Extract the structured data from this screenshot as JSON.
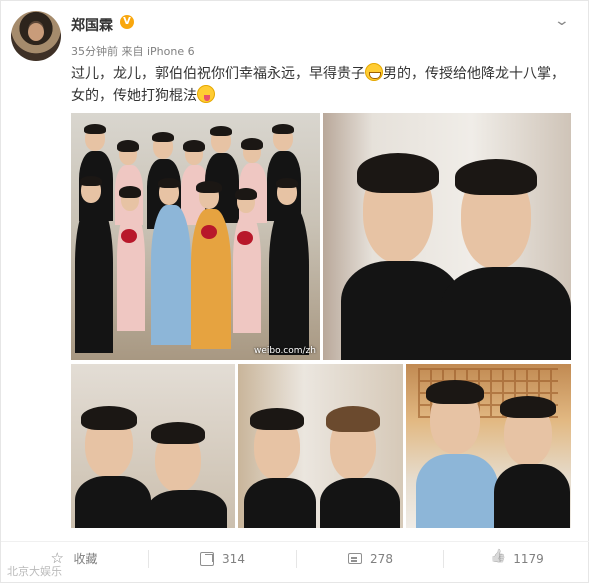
{
  "post": {
    "username": "郑国霖",
    "verified_badge": "V",
    "meta": "35分钟前 来自 iPhone 6",
    "text_lines": [
      "过儿，龙儿，郭伯伯祝你们幸福永远，早得贵子",
      "男的，传授给他降龙十八掌，",
      "女的，传她打狗棍法"
    ],
    "photo_watermark": "weibo.com/zh"
  },
  "actions": {
    "favorite_label": "收藏",
    "share_count": "314",
    "comment_count": "278",
    "like_count": "1179"
  },
  "site_watermark": "北京大娱乐",
  "icons": {
    "more": "chevron-down-icon",
    "favorite": "star-icon",
    "share": "share-icon",
    "comment": "comment-icon",
    "like": "thumbs-up-icon"
  },
  "colors": {
    "badge": "#f9a70d",
    "meta_gray": "#808080"
  }
}
